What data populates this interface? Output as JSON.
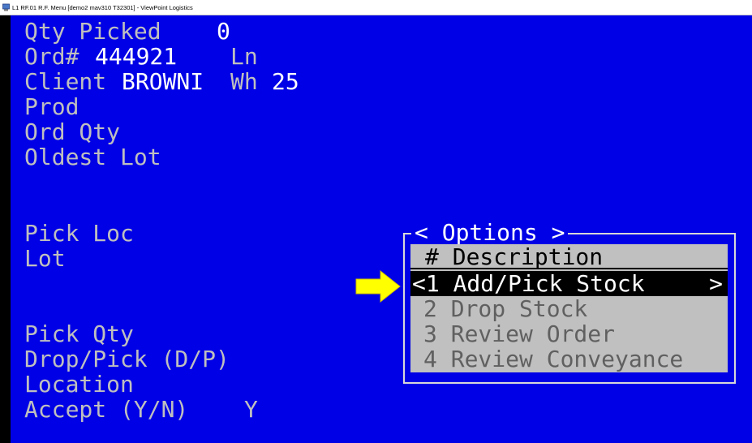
{
  "window": {
    "title": "L1 RF.01 R.F. Menu [demo2 mav310 T32301] - ViewPoint Logistics"
  },
  "screen": {
    "qty_picked_label": "Qty Picked",
    "qty_picked_value": "0",
    "ord_label": "Ord#",
    "ord_value": "444921",
    "ln_label": "Ln",
    "client_label": "Client",
    "client_value": "BROWNI",
    "wh_label": "Wh",
    "wh_value": "25",
    "prod_label": "Prod",
    "ord_qty_label": "Ord Qty",
    "oldest_lot_label": "Oldest Lot",
    "pick_loc_label": "Pick Loc",
    "lot_label": "Lot",
    "pick_qty_label": "Pick Qty",
    "drop_pick_label": "Drop/Pick (D/P)",
    "location_label": "Location",
    "accept_label": "Accept (Y/N)",
    "accept_value": "Y"
  },
  "options_menu": {
    "title": "< Options >",
    "header": "# Description",
    "items": [
      {
        "label": "<1 Add/Pick Stock",
        "suffix": ">",
        "selected": true
      },
      {
        "label": "2 Drop Stock",
        "selected": false
      },
      {
        "label": "3 Review Order",
        "selected": false
      },
      {
        "label": "4 Review Conveyance",
        "selected": false
      }
    ]
  },
  "colors": {
    "terminal_background": "#0000e6",
    "menu_background": "#c0c0c0",
    "selection_background": "#000000",
    "arrow": "#ffff00"
  },
  "icons": {
    "app": "terminal-app-icon",
    "pointer": "arrow-right-icon"
  }
}
